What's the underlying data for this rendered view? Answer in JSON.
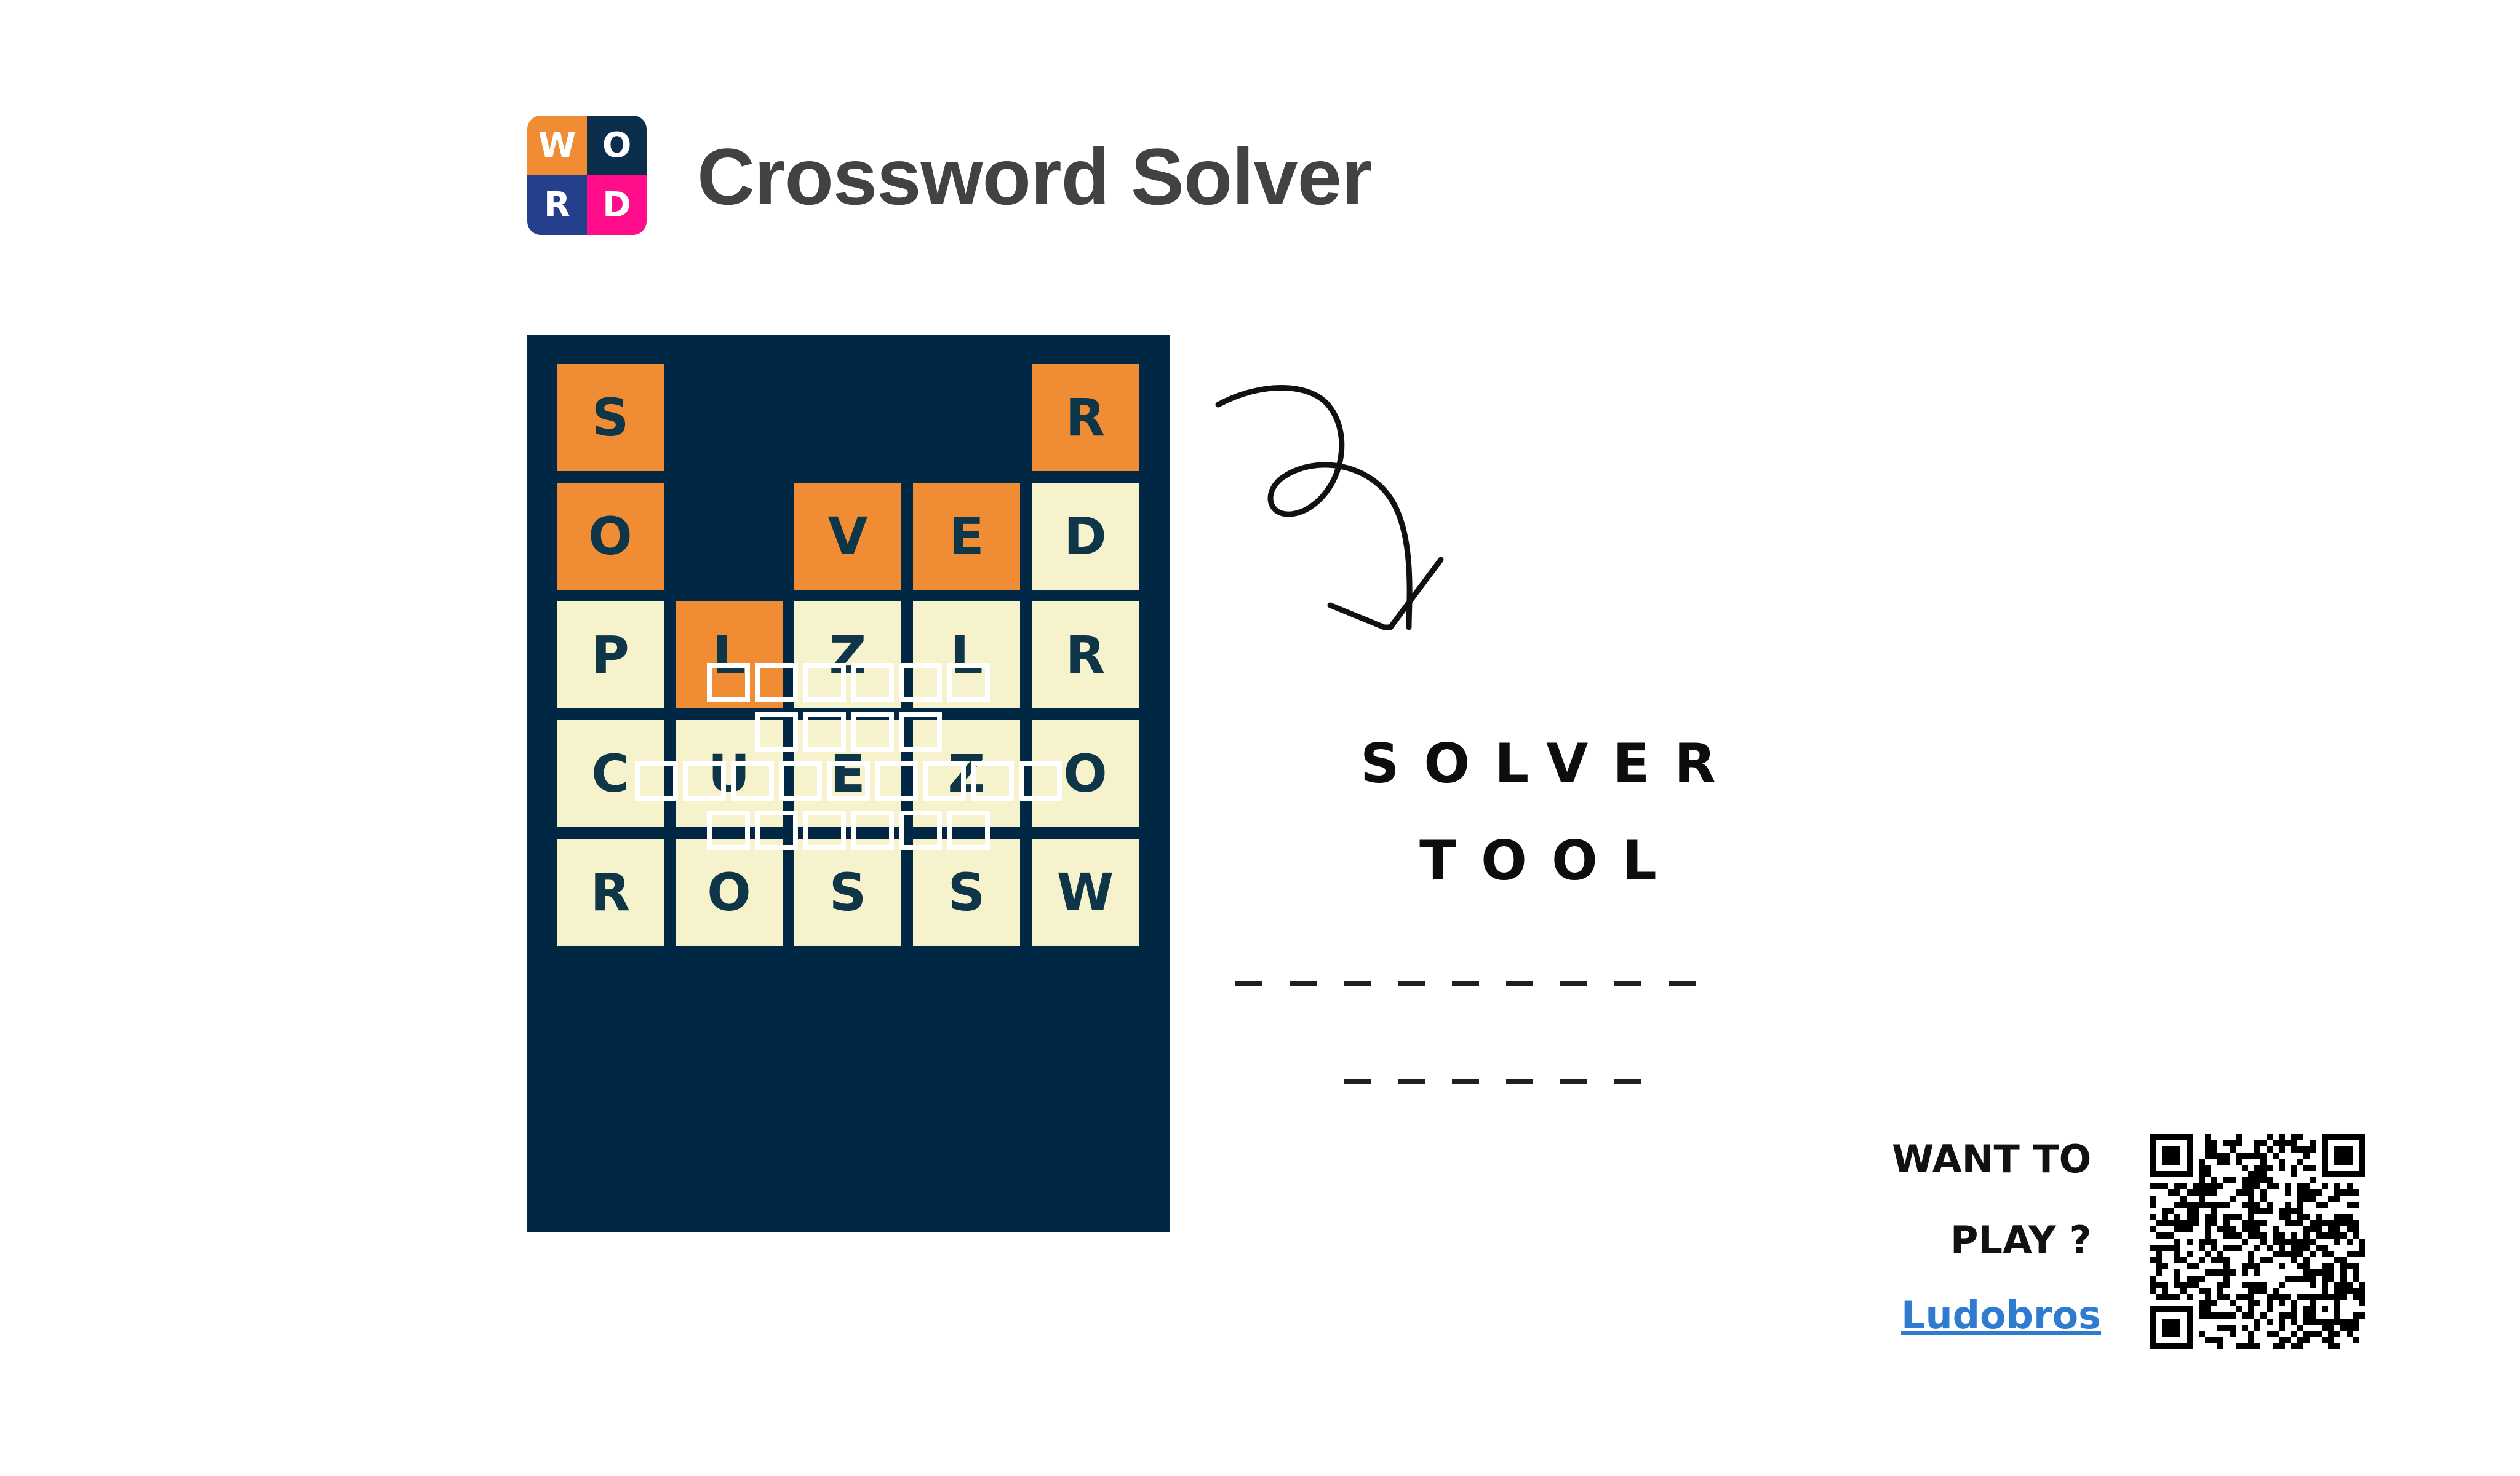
{
  "header": {
    "logo_letters": [
      "W",
      "O",
      "R",
      "D"
    ],
    "logo_colors": [
      "#f08d34",
      "#0b2e4c",
      "#243f8c",
      "#ff0d8a"
    ],
    "title": "Crossword Solver"
  },
  "board": {
    "background": "#002744",
    "rows": [
      [
        {
          "letter": "S",
          "style": "orange"
        },
        null,
        null,
        null,
        {
          "letter": "R",
          "style": "orange"
        }
      ],
      [
        {
          "letter": "O",
          "style": "orange"
        },
        null,
        {
          "letter": "V",
          "style": "orange"
        },
        {
          "letter": "E",
          "style": "orange"
        },
        {
          "letter": "D",
          "style": "cream"
        }
      ],
      [
        {
          "letter": "P",
          "style": "cream"
        },
        {
          "letter": "L",
          "style": "orange"
        },
        {
          "letter": "Z",
          "style": "cream"
        },
        {
          "letter": "L",
          "style": "cream"
        },
        {
          "letter": "R",
          "style": "cream"
        }
      ],
      [
        {
          "letter": "C",
          "style": "cream"
        },
        {
          "letter": "U",
          "style": "cream"
        },
        {
          "letter": "E",
          "style": "cream"
        },
        {
          "letter": "Z",
          "style": "cream"
        },
        {
          "letter": "O",
          "style": "cream"
        }
      ],
      [
        {
          "letter": "R",
          "style": "cream"
        },
        {
          "letter": "O",
          "style": "cream"
        },
        {
          "letter": "S",
          "style": "cream"
        },
        {
          "letter": "S",
          "style": "cream"
        },
        {
          "letter": "W",
          "style": "cream"
        }
      ]
    ],
    "blank_word_lengths": [
      6,
      4,
      9,
      6
    ],
    "colors": {
      "orange": "#f08d34",
      "cream": "#f6f2cb",
      "letter": "#0f3549"
    }
  },
  "arrow_icon": "curly-arrow-down-icon",
  "solver": {
    "line1": "SOLVER",
    "line2": "TOOL",
    "dash_counts": [
      9,
      6
    ]
  },
  "cta": {
    "line1": "WANT TO",
    "line2": "PLAY ?",
    "link": "Ludobros",
    "link_color": "#2f7bd0",
    "qr_icon": "qr-code-icon"
  }
}
